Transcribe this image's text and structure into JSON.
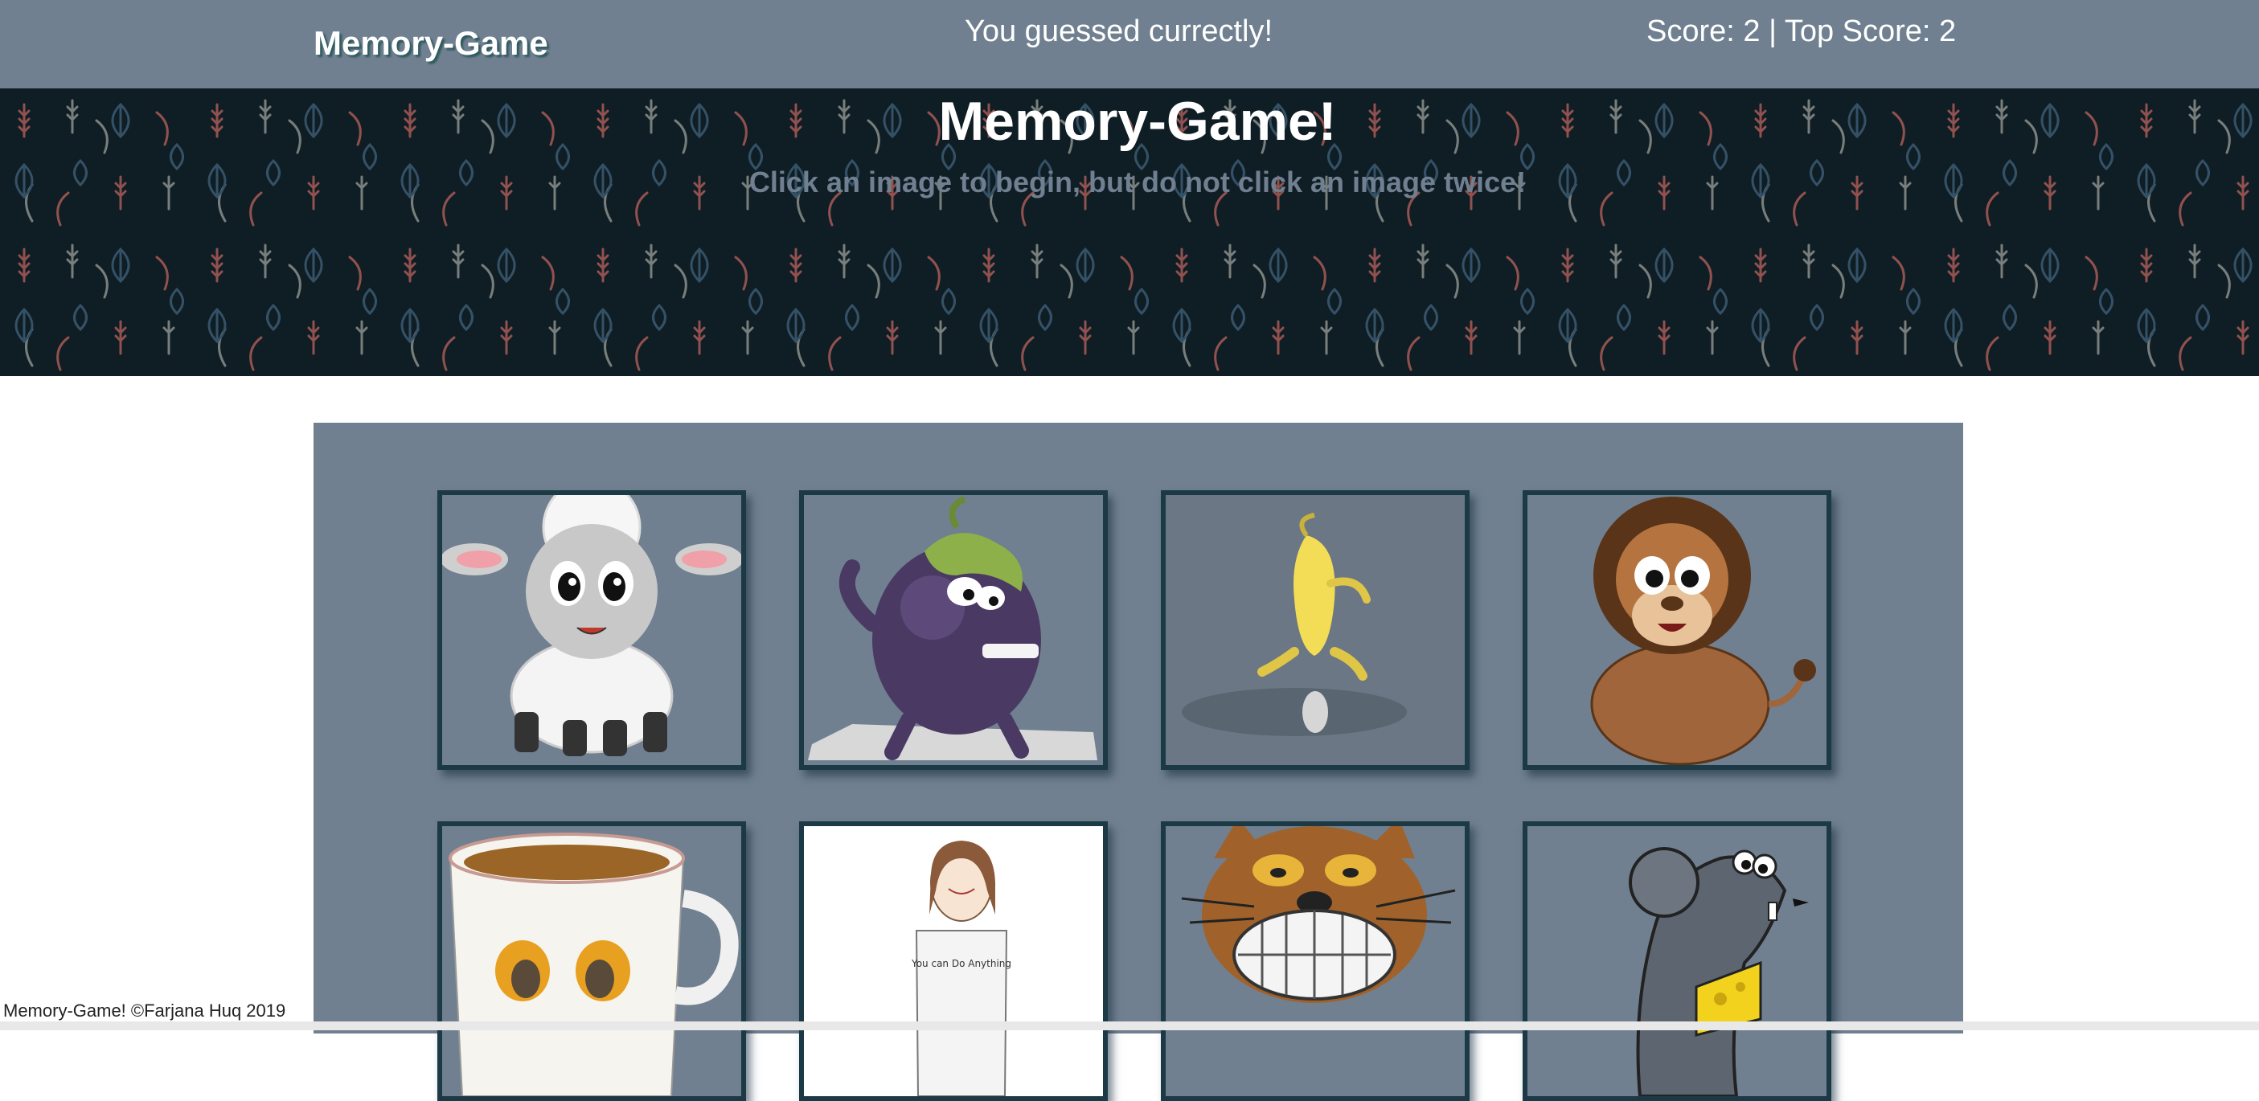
{
  "navbar": {
    "brand": "Memory-Game",
    "message": "You guessed currectly!",
    "score_text": "Score: 2 | Top Score: 2"
  },
  "hero": {
    "title": "Memory-Game!",
    "subtitle": "Click an image to begin, but do not click an image twice!"
  },
  "cards": [
    {
      "name": "sheep-card",
      "image": "cartoon-sheep"
    },
    {
      "name": "eggplant-card",
      "image": "cartoon-eggplant"
    },
    {
      "name": "banana-card",
      "image": "cartoon-banana"
    },
    {
      "name": "lion-card",
      "image": "cartoon-lion"
    },
    {
      "name": "coffee-cup-card",
      "image": "cartoon-coffee-cup"
    },
    {
      "name": "girl-card",
      "image": "sketch-girl",
      "shirt_text": "You can Do Anything"
    },
    {
      "name": "cat-card",
      "image": "cartoon-cat"
    },
    {
      "name": "rat-card",
      "image": "cartoon-rat"
    }
  ],
  "footer": {
    "text": "Memory-Game! ©Farjana Huq 2019"
  },
  "colors": {
    "navbar": "#708090",
    "hero_bg": "#0f1d25",
    "card_border": "#1b3a45"
  }
}
